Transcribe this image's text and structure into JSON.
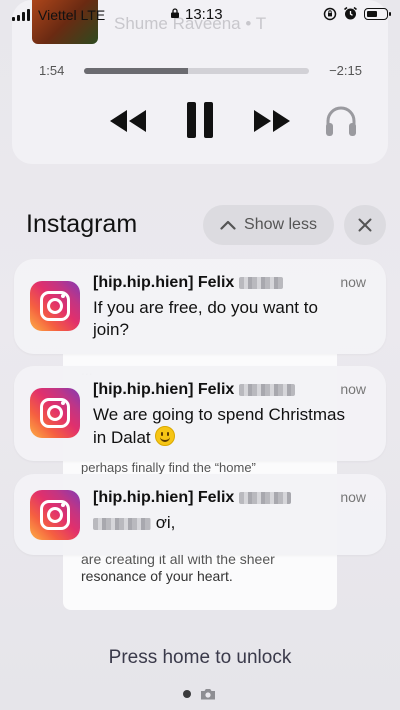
{
  "status_bar": {
    "carrier": "Viettel LTE",
    "time": "13:13",
    "battery_level": 0.6,
    "icons": [
      "signal-icon",
      "lock-icon",
      "rotation-lock-icon",
      "alarm-icon",
      "battery-icon"
    ]
  },
  "now_playing": {
    "track_text": "Shume    Raveena • T",
    "elapsed": "1:54",
    "remaining": "−2:15",
    "progress": 0.46,
    "controls": [
      "rewind-icon",
      "pause-icon",
      "fast-forward-icon",
      "airpods-icon"
    ]
  },
  "notification_group": {
    "app_name": "Instagram",
    "show_less_label": "Show less",
    "notifications": [
      {
        "sender": "[hip.hip.hien] Felix",
        "time": "now",
        "message": "If you are free, do you want to join?"
      },
      {
        "sender": "[hip.hip.hien] Felix",
        "time": "now",
        "message": "We are going to spend Christmas in Dalat"
      },
      {
        "sender": "[hip.hip.hien] Felix",
        "time": "now",
        "message": "ơi,"
      }
    ]
  },
  "background_card": {
    "line1": "...",
    "line2": "perhaps finally find the “home”",
    "line3": "are creating it all with the sheer",
    "line4": "resonance of your heart."
  },
  "lock_hint": "Press home to unlock",
  "colors": {
    "background": "#e8e7ec",
    "card": "#f3f2f6",
    "pill": "#dcdbe0",
    "instagram_accent": "#e1306c"
  }
}
